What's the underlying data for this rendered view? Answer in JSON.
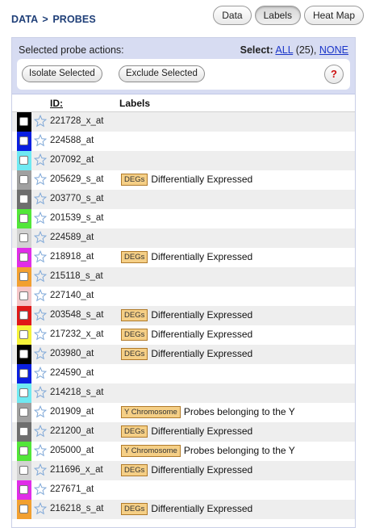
{
  "breadcrumb": {
    "section": "DATA",
    "separator": ">",
    "page": "PROBES"
  },
  "tabs": [
    {
      "label": "Data",
      "active": false
    },
    {
      "label": "Labels",
      "active": true
    },
    {
      "label": "Heat Map",
      "active": false
    }
  ],
  "actions": {
    "title": "Selected probe actions:",
    "select_label": "Select:",
    "select_all": "ALL",
    "select_count": "(25),",
    "select_none": "NONE",
    "isolate_label": "Isolate Selected",
    "exclude_label": "Exclude Selected",
    "help_label": "?"
  },
  "table": {
    "col_id": "ID:",
    "col_labels": "Labels",
    "rows": [
      {
        "id": "221728_x_at",
        "color": "#000000",
        "tag": "",
        "label": ""
      },
      {
        "id": "224588_at",
        "color": "#0a1fe0",
        "tag": "",
        "label": ""
      },
      {
        "id": "207092_at",
        "color": "#6fe9f2",
        "tag": "",
        "label": ""
      },
      {
        "id": "205629_s_at",
        "color": "#a0a0a0",
        "tag": "DEGs",
        "label": "Differentially Expressed"
      },
      {
        "id": "203770_s_at",
        "color": "#6e6e6e",
        "tag": "",
        "label": ""
      },
      {
        "id": "201539_s_at",
        "color": "#52e63a",
        "tag": "",
        "label": ""
      },
      {
        "id": "224589_at",
        "color": "#d2d2d2",
        "tag": "",
        "label": ""
      },
      {
        "id": "218918_at",
        "color": "#e02de8",
        "tag": "DEGs",
        "label": "Differentially Expressed"
      },
      {
        "id": "215118_s_at",
        "color": "#f2a030",
        "tag": "",
        "label": ""
      },
      {
        "id": "227140_at",
        "color": "#f4c6c8",
        "tag": "",
        "label": ""
      },
      {
        "id": "203548_s_at",
        "color": "#e01818",
        "tag": "DEGs",
        "label": "Differentially Expressed"
      },
      {
        "id": "217232_x_at",
        "color": "#f5f23a",
        "tag": "DEGs",
        "label": "Differentially Expressed"
      },
      {
        "id": "203980_at",
        "color": "#000000",
        "tag": "DEGs",
        "label": "Differentially Expressed"
      },
      {
        "id": "224590_at",
        "color": "#0a1fe0",
        "tag": "",
        "label": ""
      },
      {
        "id": "214218_s_at",
        "color": "#6fe9f2",
        "tag": "",
        "label": ""
      },
      {
        "id": "201909_at",
        "color": "#a0a0a0",
        "tag": "Y Chromosome",
        "label": "Probes belonging to the Y"
      },
      {
        "id": "221200_at",
        "color": "#6e6e6e",
        "tag": "DEGs",
        "label": "Differentially Expressed"
      },
      {
        "id": "205000_at",
        "color": "#52e63a",
        "tag": "Y Chromosome",
        "label": "Probes belonging to the Y"
      },
      {
        "id": "211696_x_at",
        "color": "#d2d2d2",
        "tag": "DEGs",
        "label": "Differentially Expressed"
      },
      {
        "id": "227671_at",
        "color": "#e02de8",
        "tag": "",
        "label": ""
      },
      {
        "id": "216218_s_at",
        "color": "#f2a030",
        "tag": "DEGs",
        "label": "Differentially Expressed"
      }
    ]
  },
  "icons": {
    "star": "star-outline-icon",
    "help": "help-icon"
  },
  "colors": {
    "tag_bg": "#f5cf86",
    "link": "#1a35c9",
    "panel_bg": "#d7dcf2"
  }
}
